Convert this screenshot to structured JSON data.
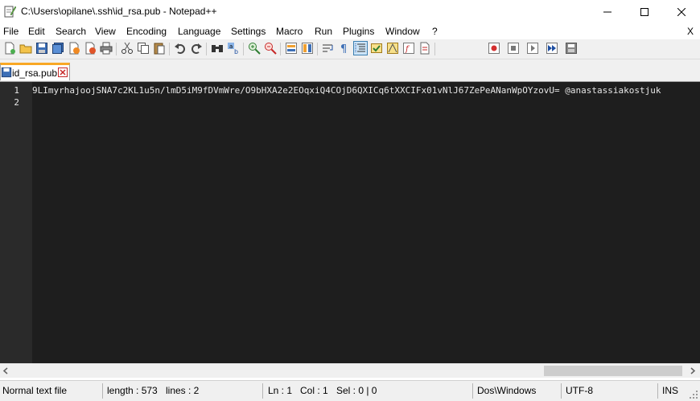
{
  "window": {
    "title": "C:\\Users\\opilane\\.ssh\\id_rsa.pub - Notepad++"
  },
  "menu": {
    "items": [
      "File",
      "Edit",
      "Search",
      "View",
      "Encoding",
      "Language",
      "Settings",
      "Macro",
      "Run",
      "Plugins",
      "Window",
      "?"
    ],
    "close_label": "X"
  },
  "tabs": [
    {
      "label": "id_rsa.pub"
    }
  ],
  "editor": {
    "lines": [
      {
        "number": "1",
        "text": "9LImyrhajoojSNA7c2KL1u5n/lmD5iM9fDVmWre/O9bHXA2e2EOqxiQ4COjD6QXICq6tXXCIFx01vNlJ67ZePeANanWpOYzovU= @anastassiakostjuk"
      },
      {
        "number": "2",
        "text": ""
      }
    ]
  },
  "statusbar": {
    "type": "Normal text file",
    "length": "length : 573",
    "lines": "lines : 2",
    "ln": "Ln : 1",
    "col": "Col : 1",
    "sel": "Sel : 0 | 0",
    "eol": "Dos\\Windows",
    "encoding": "UTF-8",
    "mode": "INS"
  },
  "colors": {
    "editor_bg": "#1e1e1e",
    "tab_accent": "#f9a825",
    "text": "#e6e6e6"
  }
}
